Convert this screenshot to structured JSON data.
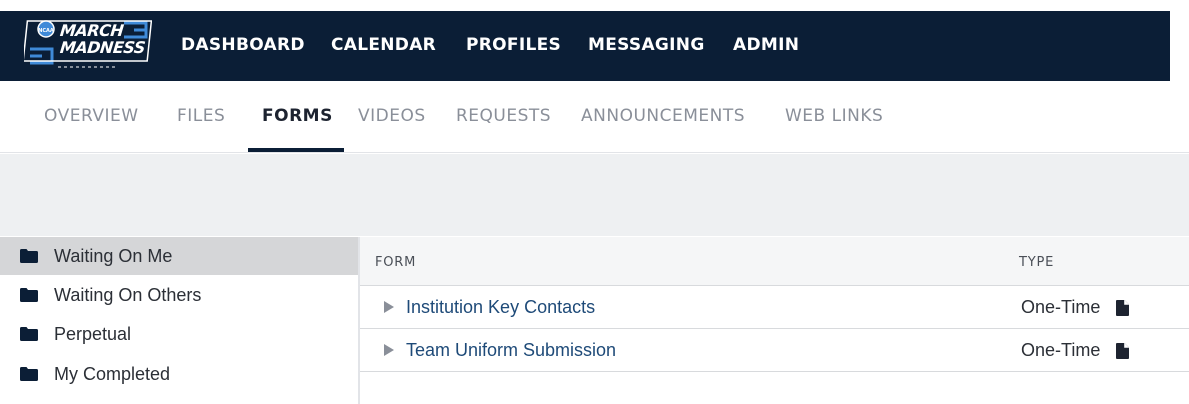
{
  "brand": {
    "line1": "MARCH",
    "line2": "MADNESS",
    "colors": {
      "navy": "#0b1e36",
      "link": "#1e4a78"
    }
  },
  "main_nav": [
    {
      "label": "DASHBOARD"
    },
    {
      "label": "CALENDAR"
    },
    {
      "label": "PROFILES"
    },
    {
      "label": "MESSAGING"
    },
    {
      "label": "ADMIN"
    }
  ],
  "sub_nav": {
    "tabs": [
      {
        "label": "OVERVIEW"
      },
      {
        "label": "FILES"
      },
      {
        "label": "FORMS",
        "active": true
      },
      {
        "label": "VIDEOS"
      },
      {
        "label": "REQUESTS"
      },
      {
        "label": "ANNOUNCEMENTS"
      },
      {
        "label": "WEB LINKS"
      }
    ]
  },
  "sidebar": {
    "items": [
      {
        "label": "Waiting On Me",
        "icon": "folder-icon",
        "selected": true
      },
      {
        "label": "Waiting On Others",
        "icon": "folder-icon"
      },
      {
        "label": "Perpetual",
        "icon": "folder-icon"
      },
      {
        "label": "My Completed",
        "icon": "folder-icon"
      }
    ]
  },
  "table": {
    "headers": {
      "form": "FORM",
      "type": "TYPE"
    },
    "rows": [
      {
        "form": "Institution Key Contacts",
        "type": "One-Time",
        "icon": "document-icon"
      },
      {
        "form": "Team Uniform Submission",
        "type": "One-Time",
        "icon": "document-icon"
      }
    ]
  }
}
